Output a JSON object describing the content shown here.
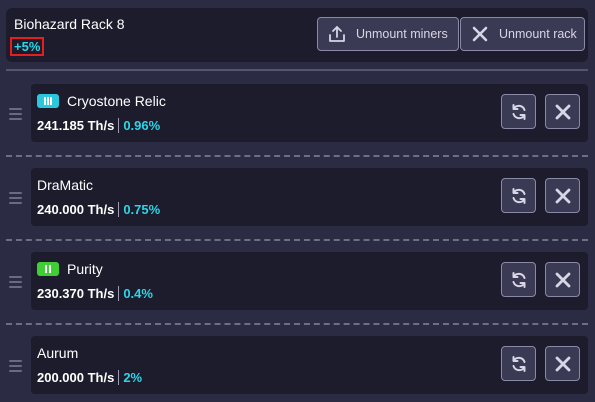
{
  "rack": {
    "title": "Biohazard Rack 8",
    "bonus": "+5%",
    "unmount_miners_label": "Unmount miners",
    "unmount_rack_label": "Unmount rack"
  },
  "miners": [
    {
      "name": "Cryostone Relic",
      "tier": "III",
      "hashrate": "241.185 Th/s",
      "percent": "0.96%"
    },
    {
      "name": "DraMatic",
      "tier": "",
      "hashrate": "240.000 Th/s",
      "percent": "0.75%"
    },
    {
      "name": "Purity",
      "tier": "II",
      "hashrate": "230.370 Th/s",
      "percent": "0.4%"
    },
    {
      "name": "Aurum",
      "tier": "",
      "hashrate": "200.000 Th/s",
      "percent": "2%"
    }
  ],
  "icons": {
    "unmount_miners": "upload-icon",
    "unmount_rack": "close-icon",
    "refresh": "refresh-icon",
    "remove": "close-icon",
    "drag": "drag-handle-icon"
  },
  "colors": {
    "background": "#2b2c44",
    "card": "#1c1c2d",
    "accent_cyan": "#2ad6e8",
    "tier_III": "#2bc8dd",
    "tier_II": "#3fcf34",
    "bonus_border": "#e51f1f"
  }
}
